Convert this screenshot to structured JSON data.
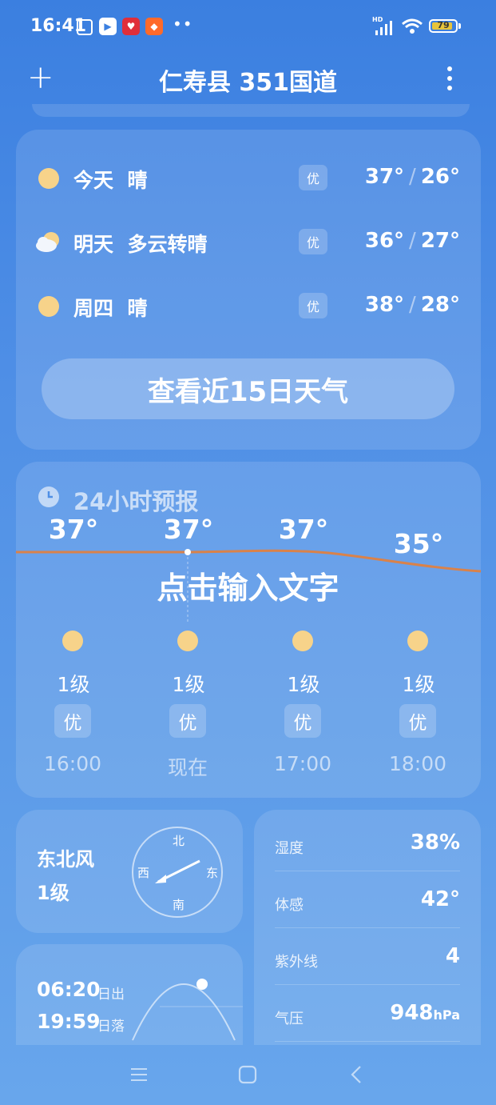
{
  "status_bar": {
    "time": "16:41",
    "hd": "HD",
    "dots": "••",
    "battery": "79"
  },
  "header": {
    "title": "仁寿县 351国道",
    "add_icon": "plus-icon",
    "more_icon": "more-vert-icon"
  },
  "daily": [
    {
      "day": "今天",
      "weather": "晴",
      "icon": "sun-icon",
      "aqi": "优",
      "high": "37°",
      "low": "26°"
    },
    {
      "day": "明天",
      "weather": "多云转晴",
      "icon": "partly-cloudy-icon",
      "aqi": "优",
      "high": "36°",
      "low": "27°"
    },
    {
      "day": "周四",
      "weather": "晴",
      "icon": "sun-icon",
      "aqi": "优",
      "high": "38°",
      "low": "28°"
    }
  ],
  "temp_sep": "/",
  "forecast_button": "查看近15日天气",
  "hourly": {
    "title": "24小时预报",
    "overlay_text": "点击输入文字",
    "items": [
      {
        "temp": "37°",
        "wind": "1级",
        "aqi": "优",
        "label": "16:00"
      },
      {
        "temp": "37°",
        "wind": "1级",
        "aqi": "优",
        "label": "现在"
      },
      {
        "temp": "37°",
        "wind": "1级",
        "aqi": "优",
        "label": "17:00"
      },
      {
        "temp": "35°",
        "wind": "1级",
        "aqi": "优",
        "label": "18:00"
      }
    ]
  },
  "wind": {
    "direction": "东北风",
    "level": "1级",
    "compass": {
      "n": "北",
      "s": "南",
      "e": "东",
      "w": "西"
    }
  },
  "sun_times": {
    "sunrise": "06:20",
    "sunrise_label": "日出",
    "sunset": "19:59",
    "sunset_label": "日落"
  },
  "details": [
    {
      "label": "湿度",
      "value": "38%",
      "unit": ""
    },
    {
      "label": "体感",
      "value": "42°",
      "unit": ""
    },
    {
      "label": "紫外线",
      "value": "4",
      "unit": ""
    },
    {
      "label": "气压",
      "value": "948",
      "unit": "hPa"
    }
  ],
  "colors": {
    "sun": "#f7d38a",
    "temp_curve": "#d9824a"
  }
}
